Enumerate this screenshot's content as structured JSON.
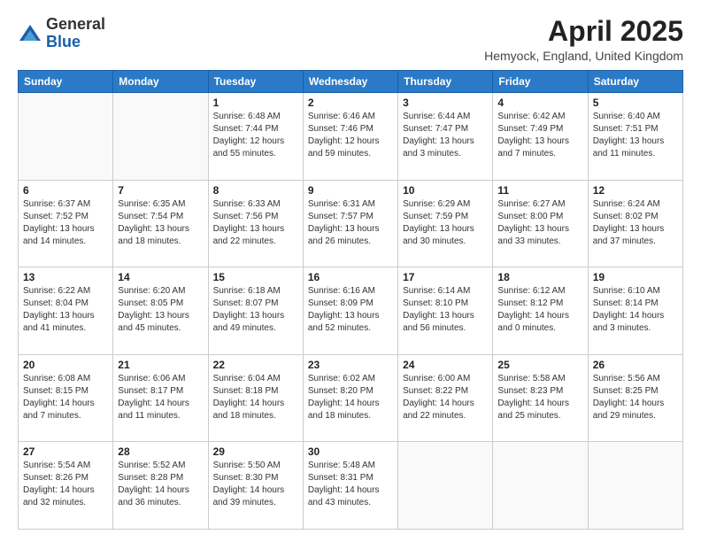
{
  "header": {
    "logo_general": "General",
    "logo_blue": "Blue",
    "main_title": "April 2025",
    "subtitle": "Hemyock, England, United Kingdom"
  },
  "calendar": {
    "headers": [
      "Sunday",
      "Monday",
      "Tuesday",
      "Wednesday",
      "Thursday",
      "Friday",
      "Saturday"
    ],
    "weeks": [
      [
        {
          "day": "",
          "sunrise": "",
          "sunset": "",
          "daylight": ""
        },
        {
          "day": "",
          "sunrise": "",
          "sunset": "",
          "daylight": ""
        },
        {
          "day": "1",
          "sunrise": "Sunrise: 6:48 AM",
          "sunset": "Sunset: 7:44 PM",
          "daylight": "Daylight: 12 hours and 55 minutes."
        },
        {
          "day": "2",
          "sunrise": "Sunrise: 6:46 AM",
          "sunset": "Sunset: 7:46 PM",
          "daylight": "Daylight: 12 hours and 59 minutes."
        },
        {
          "day": "3",
          "sunrise": "Sunrise: 6:44 AM",
          "sunset": "Sunset: 7:47 PM",
          "daylight": "Daylight: 13 hours and 3 minutes."
        },
        {
          "day": "4",
          "sunrise": "Sunrise: 6:42 AM",
          "sunset": "Sunset: 7:49 PM",
          "daylight": "Daylight: 13 hours and 7 minutes."
        },
        {
          "day": "5",
          "sunrise": "Sunrise: 6:40 AM",
          "sunset": "Sunset: 7:51 PM",
          "daylight": "Daylight: 13 hours and 11 minutes."
        }
      ],
      [
        {
          "day": "6",
          "sunrise": "Sunrise: 6:37 AM",
          "sunset": "Sunset: 7:52 PM",
          "daylight": "Daylight: 13 hours and 14 minutes."
        },
        {
          "day": "7",
          "sunrise": "Sunrise: 6:35 AM",
          "sunset": "Sunset: 7:54 PM",
          "daylight": "Daylight: 13 hours and 18 minutes."
        },
        {
          "day": "8",
          "sunrise": "Sunrise: 6:33 AM",
          "sunset": "Sunset: 7:56 PM",
          "daylight": "Daylight: 13 hours and 22 minutes."
        },
        {
          "day": "9",
          "sunrise": "Sunrise: 6:31 AM",
          "sunset": "Sunset: 7:57 PM",
          "daylight": "Daylight: 13 hours and 26 minutes."
        },
        {
          "day": "10",
          "sunrise": "Sunrise: 6:29 AM",
          "sunset": "Sunset: 7:59 PM",
          "daylight": "Daylight: 13 hours and 30 minutes."
        },
        {
          "day": "11",
          "sunrise": "Sunrise: 6:27 AM",
          "sunset": "Sunset: 8:00 PM",
          "daylight": "Daylight: 13 hours and 33 minutes."
        },
        {
          "day": "12",
          "sunrise": "Sunrise: 6:24 AM",
          "sunset": "Sunset: 8:02 PM",
          "daylight": "Daylight: 13 hours and 37 minutes."
        }
      ],
      [
        {
          "day": "13",
          "sunrise": "Sunrise: 6:22 AM",
          "sunset": "Sunset: 8:04 PM",
          "daylight": "Daylight: 13 hours and 41 minutes."
        },
        {
          "day": "14",
          "sunrise": "Sunrise: 6:20 AM",
          "sunset": "Sunset: 8:05 PM",
          "daylight": "Daylight: 13 hours and 45 minutes."
        },
        {
          "day": "15",
          "sunrise": "Sunrise: 6:18 AM",
          "sunset": "Sunset: 8:07 PM",
          "daylight": "Daylight: 13 hours and 49 minutes."
        },
        {
          "day": "16",
          "sunrise": "Sunrise: 6:16 AM",
          "sunset": "Sunset: 8:09 PM",
          "daylight": "Daylight: 13 hours and 52 minutes."
        },
        {
          "day": "17",
          "sunrise": "Sunrise: 6:14 AM",
          "sunset": "Sunset: 8:10 PM",
          "daylight": "Daylight: 13 hours and 56 minutes."
        },
        {
          "day": "18",
          "sunrise": "Sunrise: 6:12 AM",
          "sunset": "Sunset: 8:12 PM",
          "daylight": "Daylight: 14 hours and 0 minutes."
        },
        {
          "day": "19",
          "sunrise": "Sunrise: 6:10 AM",
          "sunset": "Sunset: 8:14 PM",
          "daylight": "Daylight: 14 hours and 3 minutes."
        }
      ],
      [
        {
          "day": "20",
          "sunrise": "Sunrise: 6:08 AM",
          "sunset": "Sunset: 8:15 PM",
          "daylight": "Daylight: 14 hours and 7 minutes."
        },
        {
          "day": "21",
          "sunrise": "Sunrise: 6:06 AM",
          "sunset": "Sunset: 8:17 PM",
          "daylight": "Daylight: 14 hours and 11 minutes."
        },
        {
          "day": "22",
          "sunrise": "Sunrise: 6:04 AM",
          "sunset": "Sunset: 8:18 PM",
          "daylight": "Daylight: 14 hours and 18 minutes."
        },
        {
          "day": "23",
          "sunrise": "Sunrise: 6:02 AM",
          "sunset": "Sunset: 8:20 PM",
          "daylight": "Daylight: 14 hours and 18 minutes."
        },
        {
          "day": "24",
          "sunrise": "Sunrise: 6:00 AM",
          "sunset": "Sunset: 8:22 PM",
          "daylight": "Daylight: 14 hours and 22 minutes."
        },
        {
          "day": "25",
          "sunrise": "Sunrise: 5:58 AM",
          "sunset": "Sunset: 8:23 PM",
          "daylight": "Daylight: 14 hours and 25 minutes."
        },
        {
          "day": "26",
          "sunrise": "Sunrise: 5:56 AM",
          "sunset": "Sunset: 8:25 PM",
          "daylight": "Daylight: 14 hours and 29 minutes."
        }
      ],
      [
        {
          "day": "27",
          "sunrise": "Sunrise: 5:54 AM",
          "sunset": "Sunset: 8:26 PM",
          "daylight": "Daylight: 14 hours and 32 minutes."
        },
        {
          "day": "28",
          "sunrise": "Sunrise: 5:52 AM",
          "sunset": "Sunset: 8:28 PM",
          "daylight": "Daylight: 14 hours and 36 minutes."
        },
        {
          "day": "29",
          "sunrise": "Sunrise: 5:50 AM",
          "sunset": "Sunset: 8:30 PM",
          "daylight": "Daylight: 14 hours and 39 minutes."
        },
        {
          "day": "30",
          "sunrise": "Sunrise: 5:48 AM",
          "sunset": "Sunset: 8:31 PM",
          "daylight": "Daylight: 14 hours and 43 minutes."
        },
        {
          "day": "",
          "sunrise": "",
          "sunset": "",
          "daylight": ""
        },
        {
          "day": "",
          "sunrise": "",
          "sunset": "",
          "daylight": ""
        },
        {
          "day": "",
          "sunrise": "",
          "sunset": "",
          "daylight": ""
        }
      ]
    ]
  }
}
